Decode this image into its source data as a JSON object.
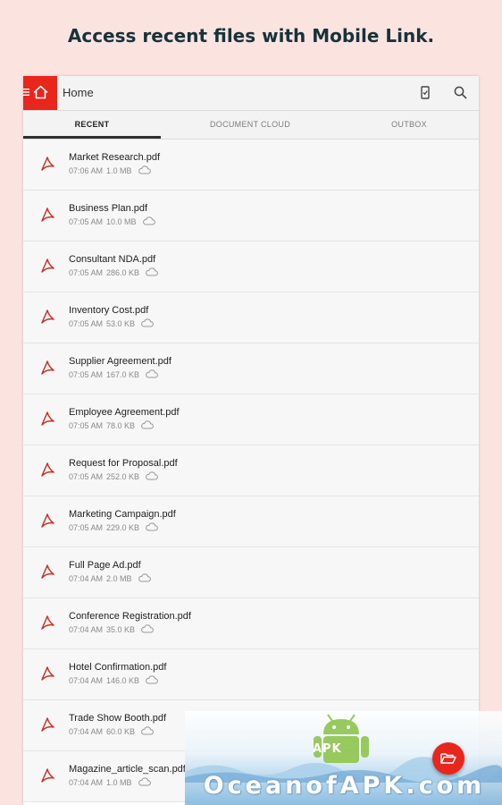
{
  "promo": {
    "headline": "Access recent files with Mobile Link."
  },
  "appbar": {
    "title": "Home",
    "icons": [
      "menu-icon",
      "house-icon",
      "mobile-link-icon",
      "search-icon"
    ]
  },
  "tabs": [
    {
      "label": "RECENT",
      "active": true
    },
    {
      "label": "DOCUMENT CLOUD",
      "active": false
    },
    {
      "label": "OUTBOX",
      "active": false
    }
  ],
  "files": [
    {
      "name": "Market Research.pdf",
      "time": "07:06 AM",
      "size": "1.0 MB"
    },
    {
      "name": "Business Plan.pdf",
      "time": "07:05 AM",
      "size": "10.0 MB"
    },
    {
      "name": "Consultant NDA.pdf",
      "time": "07:05 AM",
      "size": "286.0 KB"
    },
    {
      "name": "Inventory Cost.pdf",
      "time": "07:05 AM",
      "size": "53.0 KB"
    },
    {
      "name": "Supplier Agreement.pdf",
      "time": "07:05 AM",
      "size": "167.0 KB"
    },
    {
      "name": "Employee Agreement.pdf",
      "time": "07:05 AM",
      "size": "78.0 KB"
    },
    {
      "name": "Request for Proposal.pdf",
      "time": "07:05 AM",
      "size": "252.0 KB"
    },
    {
      "name": "Marketing Campaign.pdf",
      "time": "07:05 AM",
      "size": "229.0 KB"
    },
    {
      "name": "Full Page Ad.pdf",
      "time": "07:04 AM",
      "size": "2.0 MB"
    },
    {
      "name": "Conference Registration.pdf",
      "time": "07:04 AM",
      "size": "35.0 KB"
    },
    {
      "name": "Hotel Confirmation.pdf",
      "time": "07:04 AM",
      "size": "146.0 KB"
    },
    {
      "name": "Trade Show Booth.pdf",
      "time": "07:04 AM",
      "size": "60.0 KB"
    },
    {
      "name": "Magazine_article_scan.pdf",
      "time": "07:04 AM",
      "size": "1.0 MB"
    }
  ],
  "fab": {
    "icon": "open-folder-icon"
  },
  "watermark": {
    "badge": "APK",
    "text": "OceanofAPK.com"
  },
  "colors": {
    "accent": "#e8261c",
    "background": "#fbe4e0",
    "headline": "#18323a"
  }
}
